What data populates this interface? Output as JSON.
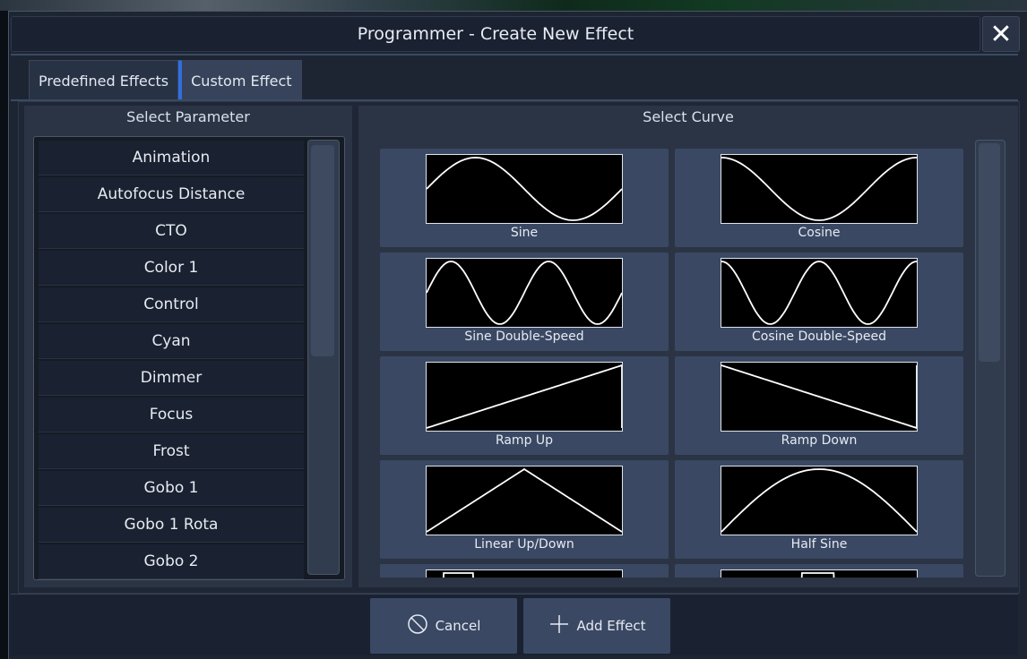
{
  "dialog": {
    "title": "Programmer - Create New Effect",
    "close_icon": "close-icon"
  },
  "tabs": [
    {
      "label": "Predefined Effects",
      "active": false
    },
    {
      "label": "Custom Effect",
      "active": true
    }
  ],
  "parameters": {
    "header": "Select Parameter",
    "items": [
      "Animation",
      "Autofocus Distance",
      "CTO",
      "Color 1",
      "Control",
      "Cyan",
      "Dimmer",
      "Focus",
      "Frost",
      "Gobo 1",
      "Gobo 1 Rota",
      "Gobo 2"
    ]
  },
  "curves": {
    "header": "Select Curve",
    "items": [
      {
        "label": "Sine",
        "shape": "sine"
      },
      {
        "label": "Cosine",
        "shape": "cosine"
      },
      {
        "label": "Sine Double-Speed",
        "shape": "sine2"
      },
      {
        "label": "Cosine Double-Speed",
        "shape": "cosine2"
      },
      {
        "label": "Ramp Up",
        "shape": "ramp-up"
      },
      {
        "label": "Ramp Down",
        "shape": "ramp-down"
      },
      {
        "label": "Linear Up/Down",
        "shape": "triangle"
      },
      {
        "label": "Half Sine",
        "shape": "half-sine"
      },
      {
        "label": "",
        "shape": "square"
      },
      {
        "label": "",
        "shape": "square-shifted"
      }
    ]
  },
  "footer": {
    "cancel_label": "Cancel",
    "cancel_icon": "cancel-circle-icon",
    "add_label": "Add Effect",
    "add_icon": "plus-icon"
  },
  "colors": {
    "accent": "#2f6fe0",
    "card": "#3a4863",
    "panel": "#2a3444",
    "dialog": "#1d2533"
  }
}
